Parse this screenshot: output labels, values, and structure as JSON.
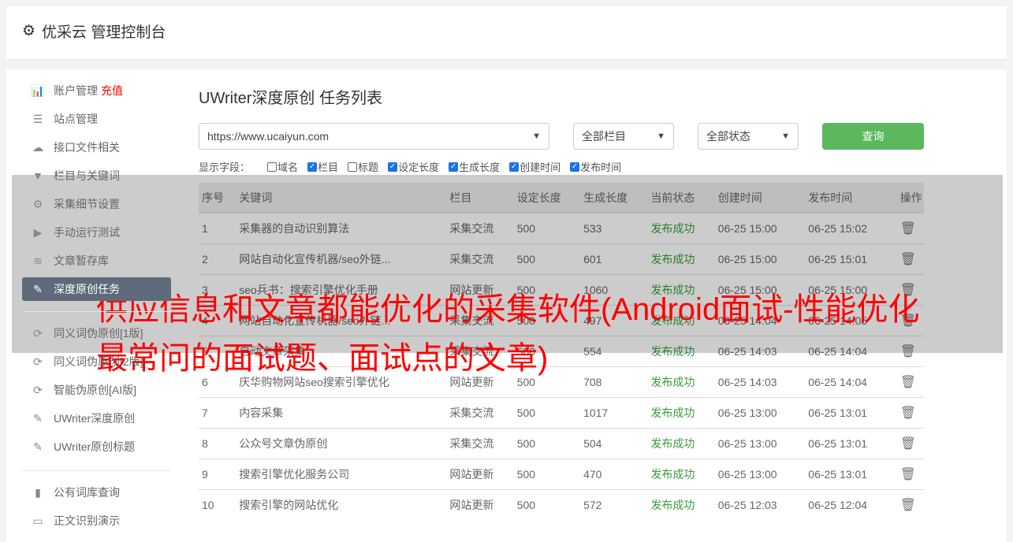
{
  "header": {
    "title": "优采云 管理控制台",
    "icon": "gear-icon"
  },
  "sidebar": {
    "groups": [
      [
        {
          "label": "账户管理",
          "badge": "充值",
          "icon": "bar-chart-icon"
        },
        {
          "label": "站点管理",
          "icon": "server-icon"
        },
        {
          "label": "接口文件相关",
          "icon": "cloud-upload-icon"
        },
        {
          "label": "栏目与关键词",
          "icon": "filter-icon"
        },
        {
          "label": "采集细节设置",
          "icon": "gears-icon"
        },
        {
          "label": "手动运行测试",
          "icon": "play-icon"
        },
        {
          "label": "文章暂存库",
          "icon": "database-icon"
        },
        {
          "label": "深度原创任务",
          "icon": "edit-icon",
          "active": true
        }
      ],
      [
        {
          "label": "同义词伪原创[1版]",
          "icon": "refresh-icon"
        },
        {
          "label": "同义词伪原创[2版]",
          "icon": "refresh-icon"
        },
        {
          "label": "智能伪原创[AI版]",
          "icon": "refresh-icon"
        },
        {
          "label": "UWriter深度原创",
          "icon": "edit-icon"
        },
        {
          "label": "UWriter原创标题",
          "icon": "edit-icon"
        }
      ],
      [
        {
          "label": "公有词库查询",
          "icon": "book-icon"
        },
        {
          "label": "正文识别演示",
          "icon": "monitor-icon"
        }
      ]
    ]
  },
  "main": {
    "title": "UWriter深度原创 任务列表",
    "site_select": "https://www.ucaiyun.com",
    "column_select": "全部栏目",
    "status_select": "全部状态",
    "query_label": "查询",
    "fields_label": "显示字段：",
    "fields": [
      {
        "label": "域名",
        "checked": false
      },
      {
        "label": "栏目",
        "checked": true
      },
      {
        "label": "标题",
        "checked": false
      },
      {
        "label": "设定长度",
        "checked": true
      },
      {
        "label": "生成长度",
        "checked": true
      },
      {
        "label": "创建时间",
        "checked": true
      },
      {
        "label": "发布时间",
        "checked": true
      }
    ],
    "columns": [
      "序号",
      "关键词",
      "栏目",
      "设定长度",
      "生成长度",
      "当前状态",
      "创建时间",
      "发布时间",
      "操作"
    ],
    "rows": [
      [
        "1",
        "采集器的自动识别算法",
        "采集交流",
        "500",
        "533",
        "发布成功",
        "06-25 15:00",
        "06-25 15:02"
      ],
      [
        "2",
        "网站自动化宣传机器/seo外链...",
        "采集交流",
        "500",
        "601",
        "发布成功",
        "06-25 15:00",
        "06-25 15:01"
      ],
      [
        "3",
        "seo兵书：搜索引擎优化手册",
        "网站更新",
        "500",
        "1060",
        "发布成功",
        "06-25 15:00",
        "06-25 15:00"
      ],
      [
        "4",
        "网站自动化宣传机器/seo外链...",
        "采集交流",
        "500",
        "497",
        "发布成功",
        "06-25 14:04",
        "06-25 14:05"
      ],
      [
        "5",
        "自动文章采集",
        "采集交流",
        "500",
        "554",
        "发布成功",
        "06-25 14:03",
        "06-25 14:04"
      ],
      [
        "6",
        "庆华购物网站seo搜索引擎优化",
        "网站更新",
        "500",
        "708",
        "发布成功",
        "06-25 14:03",
        "06-25 14:04"
      ],
      [
        "7",
        "内容采集",
        "采集交流",
        "500",
        "1017",
        "发布成功",
        "06-25 13:00",
        "06-25 13:01"
      ],
      [
        "8",
        "公众号文章伪原创",
        "采集交流",
        "500",
        "504",
        "发布成功",
        "06-25 13:00",
        "06-25 13:01"
      ],
      [
        "9",
        "搜索引擎优化服务公司",
        "网站更新",
        "500",
        "470",
        "发布成功",
        "06-25 13:00",
        "06-25 13:01"
      ],
      [
        "10",
        "搜索引擎的网站优化",
        "网站更新",
        "500",
        "572",
        "发布成功",
        "06-25 12:03",
        "06-25 12:04"
      ]
    ]
  },
  "overlay": {
    "headline": "供应信息和文章都能优化的采集软件(Android面试-性能优化最常问的面试题、面试点的文章)"
  }
}
